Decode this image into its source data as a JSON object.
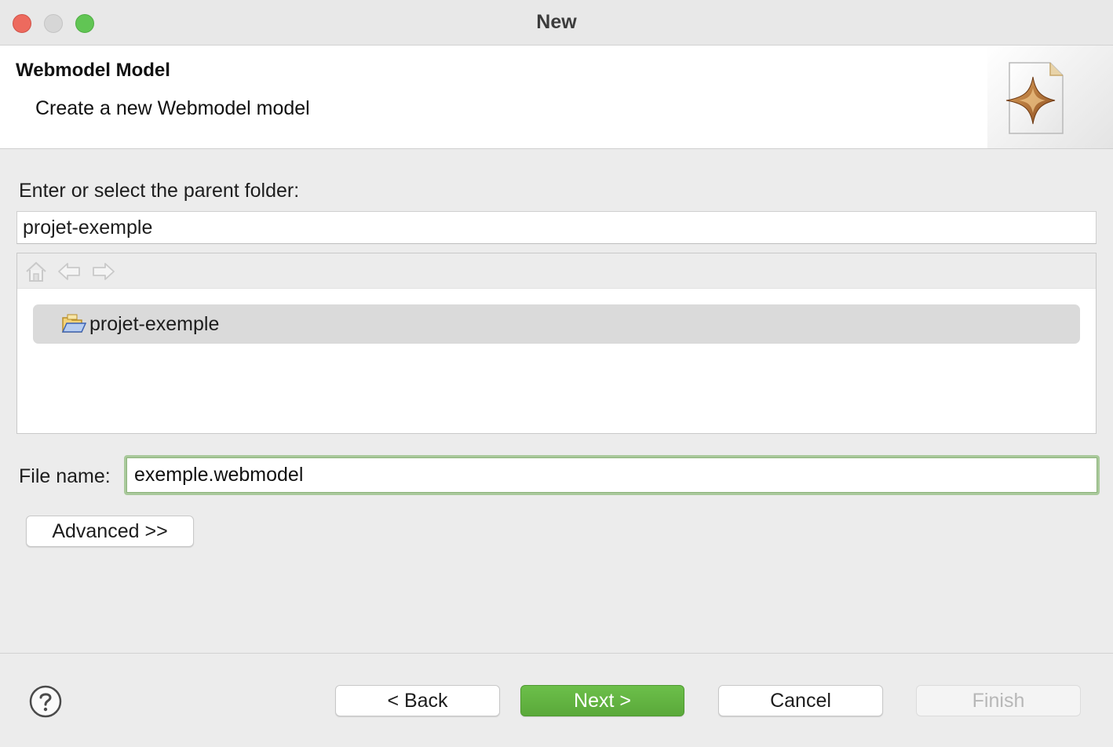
{
  "window": {
    "title": "New"
  },
  "banner": {
    "title": "Webmodel Model",
    "description": "Create a new Webmodel model",
    "icon": "wizard-new-file-icon"
  },
  "folder": {
    "label": "Enter or select the parent folder:",
    "value": "projet-exemple"
  },
  "tree": {
    "toolbar": [
      "home-icon",
      "back-arrow-icon",
      "forward-arrow-icon"
    ],
    "items": [
      {
        "label": "projet-exemple",
        "icon": "project-folder-icon",
        "selected": true
      }
    ]
  },
  "file": {
    "label": "File name:",
    "value": "exemple.webmodel"
  },
  "advanced_label": "Advanced >>",
  "buttons": {
    "back": "< Back",
    "next": "Next >",
    "cancel": "Cancel",
    "finish": "Finish"
  },
  "colors": {
    "accent": "#5fb13f",
    "focus_ring": "#a9c99b",
    "selection": "#dadada"
  }
}
